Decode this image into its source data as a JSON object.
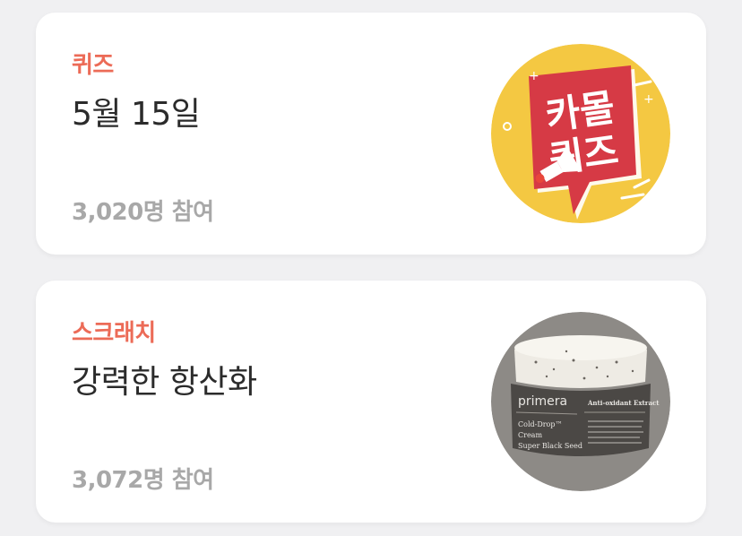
{
  "cards": [
    {
      "category": "퀴즈",
      "title": "5월 15일",
      "participants": "3,020명 참여",
      "thumbnail": {
        "icon": "karol-quiz-speech-bubble-icon",
        "text_line1": "카몰",
        "text_line2": "퀴즈",
        "bg_color": "#f4c842",
        "bubble_color": "#d63a45"
      }
    },
    {
      "category": "스크래치",
      "title": "강력한 항산화",
      "participants": "3,072명 참여",
      "thumbnail": {
        "icon": "cream-jar-product-icon",
        "brand": "primera",
        "product_line1": "Cold-Drop™",
        "product_line2": "Cream",
        "product_line3": "Super Black Seed",
        "label_title": "Anti-oxidant Extract",
        "bg_color": "#8d8a86"
      }
    }
  ],
  "colors": {
    "accent": "#ec6b57",
    "muted": "#a8a8a8",
    "title": "#2b2b2b",
    "card_bg": "#ffffff",
    "page_bg": "#f0f0f2"
  }
}
